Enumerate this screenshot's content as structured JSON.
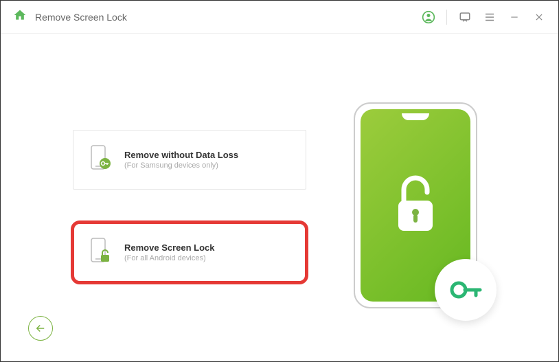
{
  "header": {
    "title": "Remove Screen Lock"
  },
  "options": [
    {
      "title": "Remove without Data Loss",
      "subtitle": "(For Samsung devices only)"
    },
    {
      "title": "Remove Screen Lock",
      "subtitle": "(For all Android devices)"
    }
  ],
  "colors": {
    "accent": "#7cb342",
    "highlight": "#e53935"
  }
}
